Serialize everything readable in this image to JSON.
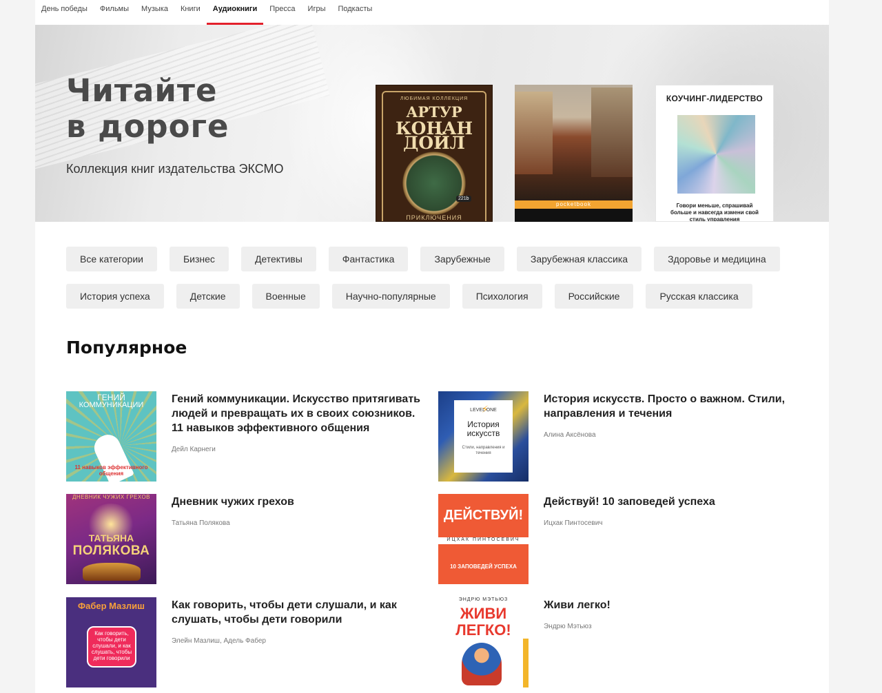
{
  "nav": {
    "items": [
      {
        "label": "День победы",
        "active": false
      },
      {
        "label": "Фильмы",
        "active": false
      },
      {
        "label": "Музыка",
        "active": false
      },
      {
        "label": "Книги",
        "active": false
      },
      {
        "label": "Аудиокниги",
        "active": true
      },
      {
        "label": "Пресса",
        "active": false
      },
      {
        "label": "Игры",
        "active": false
      },
      {
        "label": "Подкасты",
        "active": false
      }
    ],
    "accent_color": "#e3202b"
  },
  "hero": {
    "title_line1": "Читайте",
    "title_line2": "в дороге",
    "subtitle": "Коллекция книг издательства ЭКСМО",
    "books": [
      {
        "icon": "conan-doyle-book-cover",
        "series": "ЛЮБИМАЯ КОЛЛЕКЦИЯ",
        "author_line1": "АРТУР",
        "author_line2": "КОНАН ДОЙЛ",
        "badge": "221b",
        "bottom": "ПРИКЛЮЧЕНИЯ"
      },
      {
        "icon": "painting-book-cover",
        "brand": "pocketbook"
      },
      {
        "icon": "holographic-book-cover",
        "title": "КОУЧИНГ-ЛИДЕРСТВО",
        "tagline": "Говори меньше, спрашивай больше и навсегда измени свой стиль управления"
      }
    ]
  },
  "categories": {
    "row1": [
      "Все категории",
      "Бизнес",
      "Детективы",
      "Фантастика",
      "Зарубежные",
      "Зарубежная классика",
      "Здоровье и медицина"
    ],
    "row2": [
      "История успеха",
      "Детские",
      "Военные",
      "Научно-популярные",
      "Психология",
      "Российские",
      "Русская классика"
    ]
  },
  "popular": {
    "heading": "Популярное",
    "items": [
      {
        "title": "Гений коммуникации. Искусство притягивать людей и превращать их в своих союзников. 11 навыков эффективного общения",
        "author": "Дейл Карнеги",
        "cover": {
          "l1": "ГЕНИЙ",
          "l2": "КОММУНИКАЦИИ",
          "l3": "11 навыков эффективного общения"
        }
      },
      {
        "title": "История искусств. Просто о важном. Стили, направления и течения",
        "author": "Алина Аксёнова",
        "cover": {
          "l1": "LEVEL ONE",
          "l2": "История искусств",
          "l3": "Стили, направления и течения"
        }
      },
      {
        "title": "Дневник чужих грехов",
        "author": "Татьяна Полякова",
        "cover": {
          "l1": "ДНЕВНИК ЧУЖИХ ГРЕХОВ",
          "l2": "ТАТЬЯНА",
          "l3": "ПОЛЯКОВА"
        }
      },
      {
        "title": "Действуй! 10 заповедей успеха",
        "author": "Ицхак Пинтосевич",
        "cover": {
          "l1": "ДЕЙСТВУЙ!",
          "l2": "ИЦХАК ПИНТОСЕВИЧ",
          "l3": "10 ЗАПОВЕДЕЙ УСПЕХА"
        }
      },
      {
        "title": "Как говорить, чтобы дети слушали, и как слушать, чтобы дети говорили",
        "author": "Элейн Мазлиш, Адель Фабер",
        "cover": {
          "l1": "Фабер Мазлиш",
          "l2": "Как говорить, чтобы дети слушали, и как слушать, чтобы дети говорили"
        }
      },
      {
        "title": "Живи легко!",
        "author": "Эндрю Мэтьюз",
        "cover": {
          "l1": "ЭНДРЮ МЭТЬЮЗ",
          "l2": "ЖИВИ ЛЕГКО!"
        }
      }
    ]
  }
}
